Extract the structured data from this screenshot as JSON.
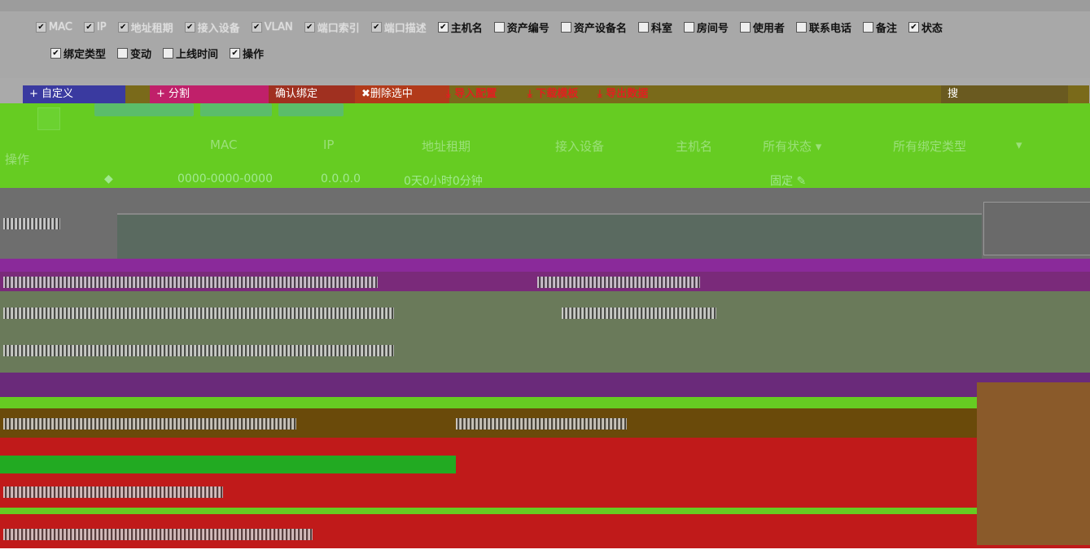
{
  "column_chooser": {
    "row1": [
      {
        "label": "MAC",
        "checked": true,
        "dim": true
      },
      {
        "label": "IP",
        "checked": true,
        "dim": true
      },
      {
        "label": "地址租期",
        "checked": true,
        "dim": true
      },
      {
        "label": "接入设备",
        "checked": true,
        "dim": true
      },
      {
        "label": "VLAN",
        "checked": true,
        "dim": true
      },
      {
        "label": "端口索引",
        "checked": true,
        "dim": true
      },
      {
        "label": "端口描述",
        "checked": true,
        "dim": true
      },
      {
        "label": "主机名",
        "checked": true
      },
      {
        "label": "资产编号",
        "checked": false
      },
      {
        "label": "资产设备名",
        "checked": false
      },
      {
        "label": "科室",
        "checked": false
      },
      {
        "label": "房间号",
        "checked": false
      },
      {
        "label": "使用者",
        "checked": false
      },
      {
        "label": "联系电话",
        "checked": false
      },
      {
        "label": "备注",
        "checked": false
      },
      {
        "label": "状态",
        "checked": true
      }
    ],
    "row2": [
      {
        "label": "绑定类型",
        "checked": true
      },
      {
        "label": "变动",
        "checked": false
      },
      {
        "label": "上线时间",
        "checked": false
      },
      {
        "label": "操作",
        "checked": true
      }
    ]
  },
  "toolbar": {
    "define_label": "+ 自定义",
    "split_label": "+ 分割",
    "bind_label": "确认绑定",
    "delete_label": "✖删除选中",
    "import_label": "⤓ 导入配置",
    "template_label": "⤓ 下载模板",
    "export_label": "⤓ 导出数据",
    "search_label": "搜"
  },
  "table": {
    "headers": {
      "operation": "操作",
      "mac": "MAC",
      "ip": "IP",
      "lease": "地址租期",
      "access_device": "接入设备",
      "hostname": "主机名",
      "status_filter": "所有状态 ▾",
      "bind_filter": "所有绑定类型",
      "bind_filter_caret": "▾"
    },
    "first_row": {
      "marker": "◆",
      "mac": "0000-0000-0000",
      "ip": "0.0.0.0",
      "lease": "0天0小时0分钟",
      "bind_type": "固定 ✎"
    }
  },
  "colors": {
    "header_green": "#66cc22",
    "corrupt_red": "#c01a1a",
    "corrupt_purple": "#8a2a9a",
    "link_red": "#e02020"
  }
}
